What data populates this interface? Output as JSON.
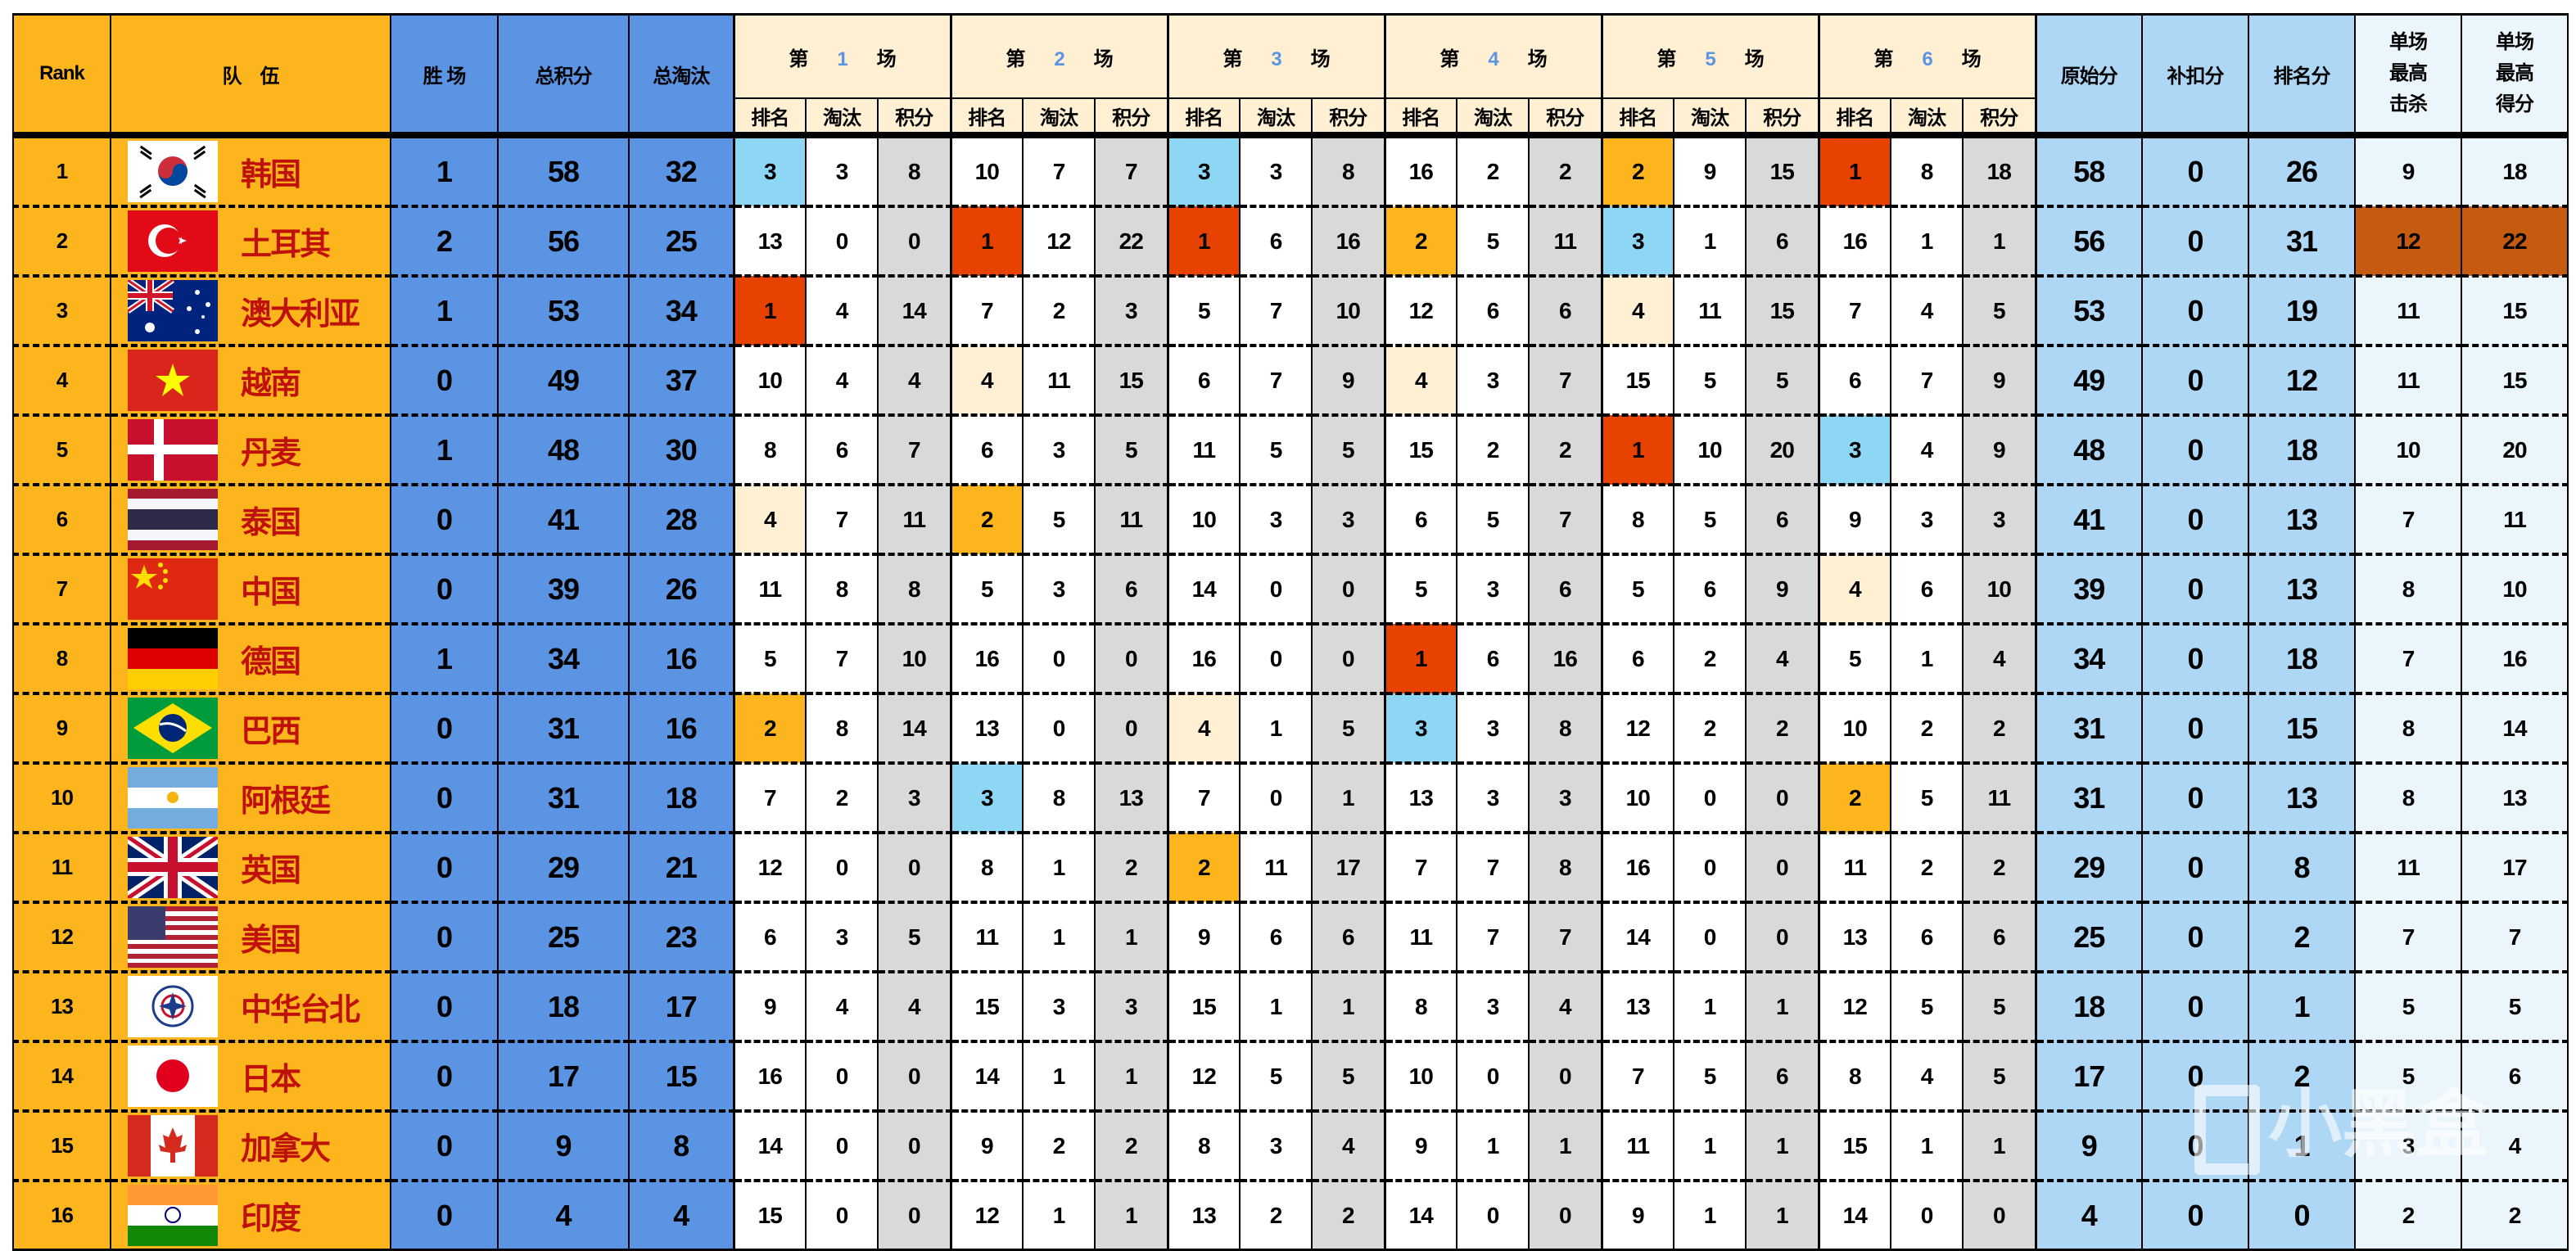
{
  "headers": {
    "rank": "Rank",
    "team": "队　伍",
    "wins": "胜 场",
    "total_points": "总积分",
    "total_kills": "总淘汰",
    "game_prefix": "第",
    "game_suffix": "场",
    "games": [
      "1",
      "2",
      "3",
      "4",
      "5",
      "6"
    ],
    "sub": [
      "排名",
      "淘汰",
      "积分"
    ],
    "raw": "原始分",
    "adjust": "补扣分",
    "placement": "排名分",
    "max_kills": "单场最高击杀",
    "max_points": "单场最高得分"
  },
  "colors": {
    "orange": "#FDB51E",
    "blue": "#5A94E2",
    "cream": "#FFF0D4",
    "gray": "#D9D9D9",
    "rank1": "#E84200",
    "rank2": "#FDB51E",
    "rank3": "#8DD7F5",
    "rank4": "#FFF0D4",
    "max_highlight": "#C55A11",
    "team_name": "#C0100A"
  },
  "single_game_max": {
    "kills": 12,
    "points": 22
  },
  "rows": [
    {
      "rank": "1",
      "flag": "flag-korea-icon",
      "team": "韩国",
      "wins": "1",
      "total": "58",
      "kills": "32",
      "games": [
        [
          "3",
          "3",
          "8"
        ],
        [
          "10",
          "7",
          "7"
        ],
        [
          "3",
          "3",
          "8"
        ],
        [
          "16",
          "2",
          "2"
        ],
        [
          "2",
          "9",
          "15"
        ],
        [
          "1",
          "8",
          "18"
        ]
      ],
      "raw": "58",
      "adjust": "0",
      "placement": "26",
      "max_kills": "9",
      "max_points": "18"
    },
    {
      "rank": "2",
      "flag": "flag-turkey-icon",
      "team": "土耳其",
      "wins": "2",
      "total": "56",
      "kills": "25",
      "games": [
        [
          "13",
          "0",
          "0"
        ],
        [
          "1",
          "12",
          "22"
        ],
        [
          "1",
          "6",
          "16"
        ],
        [
          "2",
          "5",
          "11"
        ],
        [
          "3",
          "1",
          "6"
        ],
        [
          "16",
          "1",
          "1"
        ]
      ],
      "raw": "56",
      "adjust": "0",
      "placement": "31",
      "max_kills": "12",
      "max_points": "22"
    },
    {
      "rank": "3",
      "flag": "flag-australia-icon",
      "team": "澳大利亚",
      "wins": "1",
      "total": "53",
      "kills": "34",
      "games": [
        [
          "1",
          "4",
          "14"
        ],
        [
          "7",
          "2",
          "3"
        ],
        [
          "5",
          "7",
          "10"
        ],
        [
          "12",
          "6",
          "6"
        ],
        [
          "4",
          "11",
          "15"
        ],
        [
          "7",
          "4",
          "5"
        ]
      ],
      "raw": "53",
      "adjust": "0",
      "placement": "19",
      "max_kills": "11",
      "max_points": "15"
    },
    {
      "rank": "4",
      "flag": "flag-vietnam-icon",
      "team": "越南",
      "wins": "0",
      "total": "49",
      "kills": "37",
      "games": [
        [
          "10",
          "4",
          "4"
        ],
        [
          "4",
          "11",
          "15"
        ],
        [
          "6",
          "7",
          "9"
        ],
        [
          "4",
          "3",
          "7"
        ],
        [
          "15",
          "5",
          "5"
        ],
        [
          "6",
          "7",
          "9"
        ]
      ],
      "raw": "49",
      "adjust": "0",
      "placement": "12",
      "max_kills": "11",
      "max_points": "15"
    },
    {
      "rank": "5",
      "flag": "flag-denmark-icon",
      "team": "丹麦",
      "wins": "1",
      "total": "48",
      "kills": "30",
      "games": [
        [
          "8",
          "6",
          "7"
        ],
        [
          "6",
          "3",
          "5"
        ],
        [
          "11",
          "5",
          "5"
        ],
        [
          "15",
          "2",
          "2"
        ],
        [
          "1",
          "10",
          "20"
        ],
        [
          "3",
          "4",
          "9"
        ]
      ],
      "raw": "48",
      "adjust": "0",
      "placement": "18",
      "max_kills": "10",
      "max_points": "20"
    },
    {
      "rank": "6",
      "flag": "flag-thailand-icon",
      "team": "泰国",
      "wins": "0",
      "total": "41",
      "kills": "28",
      "games": [
        [
          "4",
          "7",
          "11"
        ],
        [
          "2",
          "5",
          "11"
        ],
        [
          "10",
          "3",
          "3"
        ],
        [
          "6",
          "5",
          "7"
        ],
        [
          "8",
          "5",
          "6"
        ],
        [
          "9",
          "3",
          "3"
        ]
      ],
      "raw": "41",
      "adjust": "0",
      "placement": "13",
      "max_kills": "7",
      "max_points": "11"
    },
    {
      "rank": "7",
      "flag": "flag-china-icon",
      "team": "中国",
      "wins": "0",
      "total": "39",
      "kills": "26",
      "games": [
        [
          "11",
          "8",
          "8"
        ],
        [
          "5",
          "3",
          "6"
        ],
        [
          "14",
          "0",
          "0"
        ],
        [
          "5",
          "3",
          "6"
        ],
        [
          "5",
          "6",
          "9"
        ],
        [
          "4",
          "6",
          "10"
        ]
      ],
      "raw": "39",
      "adjust": "0",
      "placement": "13",
      "max_kills": "8",
      "max_points": "10"
    },
    {
      "rank": "8",
      "flag": "flag-germany-icon",
      "team": "德国",
      "wins": "1",
      "total": "34",
      "kills": "16",
      "games": [
        [
          "5",
          "7",
          "10"
        ],
        [
          "16",
          "0",
          "0"
        ],
        [
          "16",
          "0",
          "0"
        ],
        [
          "1",
          "6",
          "16"
        ],
        [
          "6",
          "2",
          "4"
        ],
        [
          "5",
          "1",
          "4"
        ]
      ],
      "raw": "34",
      "adjust": "0",
      "placement": "18",
      "max_kills": "7",
      "max_points": "16"
    },
    {
      "rank": "9",
      "flag": "flag-brazil-icon",
      "team": "巴西",
      "wins": "0",
      "total": "31",
      "kills": "16",
      "games": [
        [
          "2",
          "8",
          "14"
        ],
        [
          "13",
          "0",
          "0"
        ],
        [
          "4",
          "1",
          "5"
        ],
        [
          "3",
          "3",
          "8"
        ],
        [
          "12",
          "2",
          "2"
        ],
        [
          "10",
          "2",
          "2"
        ]
      ],
      "raw": "31",
      "adjust": "0",
      "placement": "15",
      "max_kills": "8",
      "max_points": "14"
    },
    {
      "rank": "10",
      "flag": "flag-argentina-icon",
      "team": "阿根廷",
      "wins": "0",
      "total": "31",
      "kills": "18",
      "games": [
        [
          "7",
          "2",
          "3"
        ],
        [
          "3",
          "8",
          "13"
        ],
        [
          "7",
          "0",
          "1"
        ],
        [
          "13",
          "3",
          "3"
        ],
        [
          "10",
          "0",
          "0"
        ],
        [
          "2",
          "5",
          "11"
        ]
      ],
      "raw": "31",
      "adjust": "0",
      "placement": "13",
      "max_kills": "8",
      "max_points": "13"
    },
    {
      "rank": "11",
      "flag": "flag-uk-icon",
      "team": "英国",
      "wins": "0",
      "total": "29",
      "kills": "21",
      "games": [
        [
          "12",
          "0",
          "0"
        ],
        [
          "8",
          "1",
          "2"
        ],
        [
          "2",
          "11",
          "17"
        ],
        [
          "7",
          "7",
          "8"
        ],
        [
          "16",
          "0",
          "0"
        ],
        [
          "11",
          "2",
          "2"
        ]
      ],
      "raw": "29",
      "adjust": "0",
      "placement": "8",
      "max_kills": "11",
      "max_points": "17"
    },
    {
      "rank": "12",
      "flag": "flag-usa-icon",
      "team": "美国",
      "wins": "0",
      "total": "25",
      "kills": "23",
      "games": [
        [
          "6",
          "3",
          "5"
        ],
        [
          "11",
          "1",
          "1"
        ],
        [
          "9",
          "6",
          "6"
        ],
        [
          "11",
          "7",
          "7"
        ],
        [
          "14",
          "0",
          "0"
        ],
        [
          "13",
          "6",
          "6"
        ]
      ],
      "raw": "25",
      "adjust": "0",
      "placement": "2",
      "max_kills": "7",
      "max_points": "7"
    },
    {
      "rank": "13",
      "flag": "flag-chinese-taipei-icon",
      "team": "中华台北",
      "wins": "0",
      "total": "18",
      "kills": "17",
      "games": [
        [
          "9",
          "4",
          "4"
        ],
        [
          "15",
          "3",
          "3"
        ],
        [
          "15",
          "1",
          "1"
        ],
        [
          "8",
          "3",
          "4"
        ],
        [
          "13",
          "1",
          "1"
        ],
        [
          "12",
          "5",
          "5"
        ]
      ],
      "raw": "18",
      "adjust": "0",
      "placement": "1",
      "max_kills": "5",
      "max_points": "5"
    },
    {
      "rank": "14",
      "flag": "flag-japan-icon",
      "team": "日本",
      "wins": "0",
      "total": "17",
      "kills": "15",
      "games": [
        [
          "16",
          "0",
          "0"
        ],
        [
          "14",
          "1",
          "1"
        ],
        [
          "12",
          "5",
          "5"
        ],
        [
          "10",
          "0",
          "0"
        ],
        [
          "7",
          "5",
          "6"
        ],
        [
          "8",
          "4",
          "5"
        ]
      ],
      "raw": "17",
      "adjust": "0",
      "placement": "2",
      "max_kills": "5",
      "max_points": "6"
    },
    {
      "rank": "15",
      "flag": "flag-canada-icon",
      "team": "加拿大",
      "wins": "0",
      "total": "9",
      "kills": "8",
      "games": [
        [
          "14",
          "0",
          "0"
        ],
        [
          "9",
          "2",
          "2"
        ],
        [
          "8",
          "3",
          "4"
        ],
        [
          "9",
          "1",
          "1"
        ],
        [
          "11",
          "1",
          "1"
        ],
        [
          "15",
          "1",
          "1"
        ]
      ],
      "raw": "9",
      "adjust": "0",
      "placement": "1",
      "max_kills": "3",
      "max_points": "4"
    },
    {
      "rank": "16",
      "flag": "flag-india-icon",
      "team": "印度",
      "wins": "0",
      "total": "4",
      "kills": "4",
      "games": [
        [
          "15",
          "0",
          "0"
        ],
        [
          "12",
          "1",
          "1"
        ],
        [
          "13",
          "2",
          "2"
        ],
        [
          "14",
          "0",
          "0"
        ],
        [
          "9",
          "1",
          "1"
        ],
        [
          "14",
          "0",
          "0"
        ]
      ],
      "raw": "4",
      "adjust": "0",
      "placement": "0",
      "max_kills": "2",
      "max_points": "2"
    }
  ],
  "watermark": "小黑盒"
}
